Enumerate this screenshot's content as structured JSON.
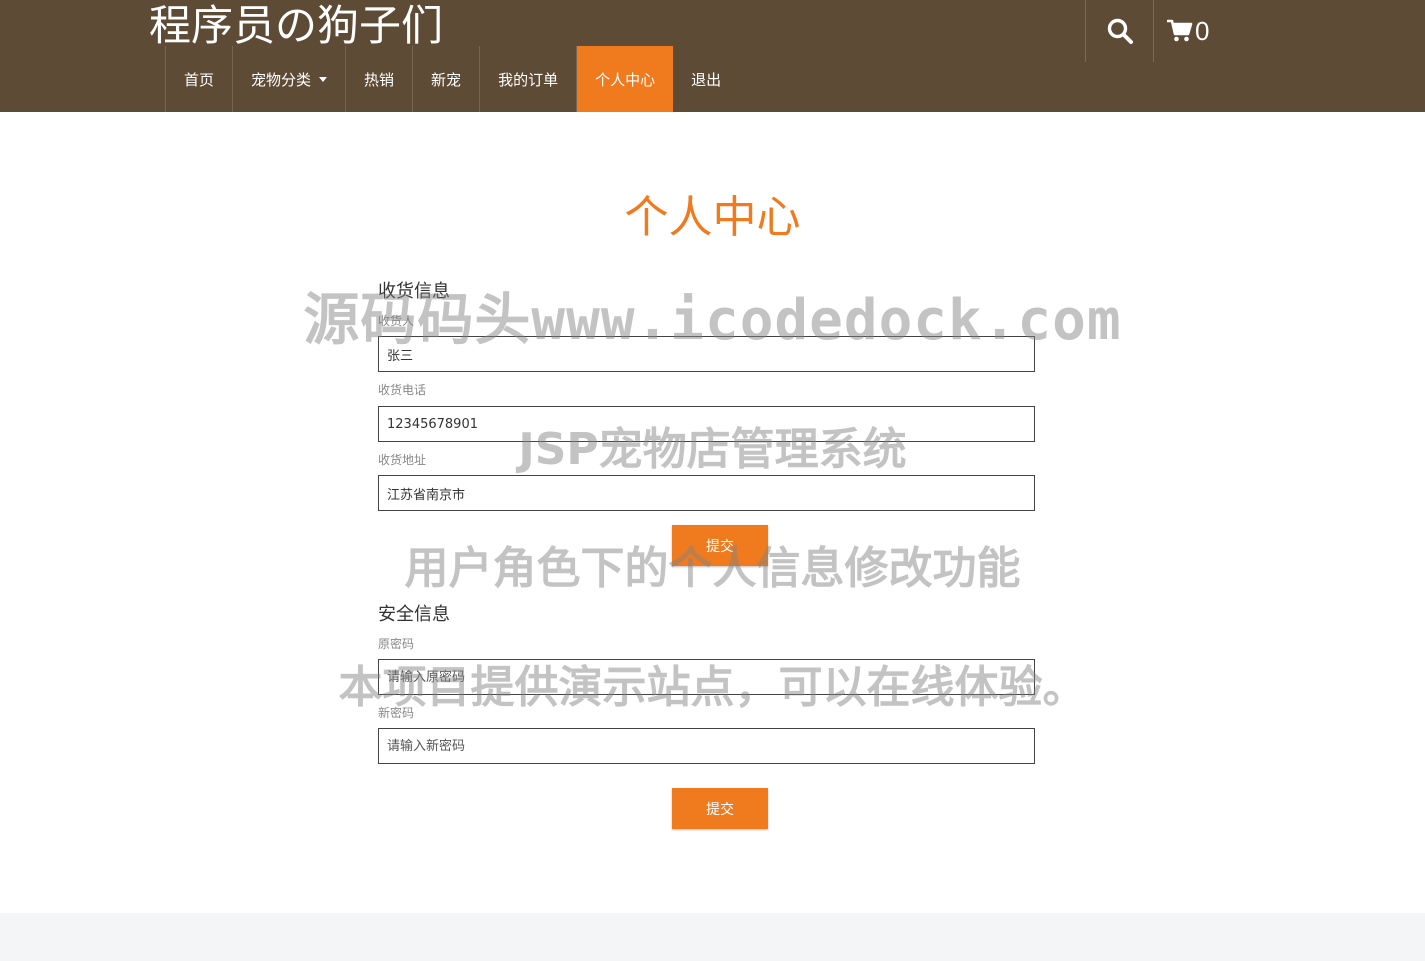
{
  "header": {
    "brand": "程序员の狗子们",
    "cart_count": "0",
    "nav": [
      {
        "label": "首页"
      },
      {
        "label": "宠物分类"
      },
      {
        "label": "热销"
      },
      {
        "label": "新宠"
      },
      {
        "label": "我的订单"
      },
      {
        "label": "个人中心"
      },
      {
        "label": "退出"
      }
    ]
  },
  "page": {
    "title": "个人中心"
  },
  "shipping": {
    "title": "收货信息",
    "name_label": "收货人",
    "name_value": "张三",
    "phone_label": "收货电话",
    "phone_value": "12345678901",
    "address_label": "收货地址",
    "address_value": "江苏省南京市",
    "submit_label": "提交"
  },
  "security": {
    "title": "安全信息",
    "old_password_label": "原密码",
    "old_password_placeholder": "请输入原密码",
    "new_password_label": "新密码",
    "new_password_placeholder": "请输入新密码",
    "submit_label": "提交"
  },
  "watermarks": {
    "line1": "源码码头www.icodedock.com",
    "line2": "JSP宠物店管理系统",
    "line3": "用户角色下的个人信息修改功能",
    "line4": "本项目提供演示站点，可以在线体验。"
  },
  "icons": {
    "search": "search-icon",
    "cart": "cart-icon",
    "caret": "caret-down-icon"
  },
  "colors": {
    "header_bg": "#5e4b35",
    "accent": "#ef7b1e",
    "footer_bg": "#f3f5f6"
  }
}
